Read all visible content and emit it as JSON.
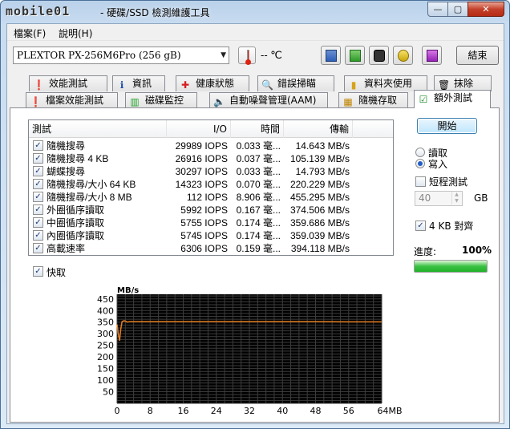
{
  "window": {
    "logo": "mobile01",
    "title": " - 硬碟/SSD 檢測維護工具",
    "minimize": "—",
    "maximize": "▢",
    "close": "✕"
  },
  "menu": {
    "file": "檔案(F)",
    "help": "說明(H)"
  },
  "toolbar": {
    "drive": "PLEXTOR PX-256M6Pro (256 gB)",
    "temperature": "-- ℃",
    "exit": "結束"
  },
  "tabs_row1": [
    "效能測試",
    "資訊",
    "健康狀態",
    "錯誤掃瞄",
    "資料夾使用",
    "抹除"
  ],
  "tabs_row2": [
    "檔案效能測試",
    "磁碟監控",
    "自動噪聲管理(AAM)",
    "隨機存取",
    "額外測試"
  ],
  "table": {
    "headers": [
      "測試",
      "I/O",
      "時間",
      "傳輸"
    ],
    "rows": [
      {
        "name": "隨機搜尋",
        "io": "29989 IOPS",
        "time": "0.033 毫...",
        "rate": "14.643 MB/s"
      },
      {
        "name": "隨機搜尋 4 KB",
        "io": "26916 IOPS",
        "time": "0.037 毫...",
        "rate": "105.139 MB/s"
      },
      {
        "name": "蝴蝶搜尋",
        "io": "30297 IOPS",
        "time": "0.033 毫...",
        "rate": "14.793 MB/s"
      },
      {
        "name": "隨機搜尋/大小 64 KB",
        "io": "14323 IOPS",
        "time": "0.070 毫...",
        "rate": "220.229 MB/s"
      },
      {
        "name": "隨機搜尋/大小 8 MB",
        "io": "112 IOPS",
        "time": "8.906 毫...",
        "rate": "455.295 MB/s"
      },
      {
        "name": "外圈循序讀取",
        "io": "5992 IOPS",
        "time": "0.167 毫...",
        "rate": "374.506 MB/s"
      },
      {
        "name": "中圈循序讀取",
        "io": "5755 IOPS",
        "time": "0.174 毫...",
        "rate": "359.686 MB/s"
      },
      {
        "name": "內圈循序讀取",
        "io": "5745 IOPS",
        "time": "0.174 毫...",
        "rate": "359.039 MB/s"
      },
      {
        "name": "高載速率",
        "io": "6306 IOPS",
        "time": "0.159 毫...",
        "rate": "394.118 MB/s"
      }
    ]
  },
  "fast_label": "快取",
  "side": {
    "start": "開始",
    "read": "讀取",
    "write": "寫入",
    "short_test": "短程測試",
    "size_value": "40",
    "size_unit": "GB",
    "align_4kb": "4 KB 對齊",
    "progress_label": "進度:",
    "progress_value": "100%",
    "progress_fraction": 1.0
  },
  "chart_data": {
    "type": "line",
    "ylabel": "MB/s",
    "xlabel": "",
    "y_ticks": [
      450,
      400,
      350,
      300,
      250,
      200,
      150,
      100,
      50
    ],
    "x_ticks": [
      "0",
      "8",
      "16",
      "24",
      "32",
      "40",
      "48",
      "56",
      "64MB"
    ],
    "xlim": [
      0,
      64
    ],
    "ylim": [
      0,
      470
    ],
    "series": [
      {
        "color": "#e67e22",
        "x": [
          0,
          0.3,
          0.6,
          0.9,
          1.2,
          1.6,
          2.0,
          2.5,
          3.0,
          4,
          8,
          16,
          24,
          32,
          40,
          48,
          56,
          64
        ],
        "values": [
          340,
          300,
          270,
          320,
          352,
          356,
          355,
          350,
          352,
          352,
          352,
          352,
          352,
          352,
          352,
          352,
          351,
          351
        ]
      }
    ],
    "grid": true
  },
  "colors": {
    "accent": "#215dc6",
    "progress": "#2fbf38",
    "line": "#e67e22"
  }
}
